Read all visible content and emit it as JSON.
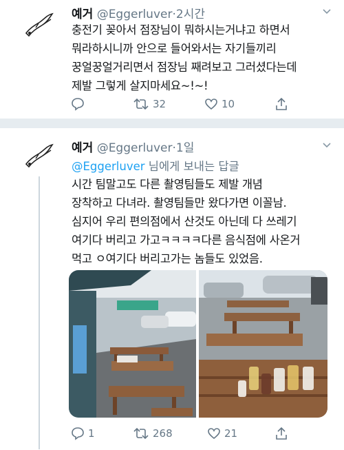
{
  "tweets": [
    {
      "name": "예거",
      "handle": "@Eggerluver",
      "separator": "·",
      "time": "2시간",
      "lines": [
        "충전기 꽂아서 점장님이 뭐하시는거냐고 하면서",
        "뭐라하시니까 안으로 들어와서는 자기들끼리",
        "꿍얼꿍얼거리면서 점장님 째려보고 그러셨다는데",
        "제발 그렇게 살지마세요~!~!"
      ],
      "actions": {
        "reply_count": "",
        "retweet_count": "32",
        "like_count": "10"
      }
    },
    {
      "name": "예거",
      "handle": "@Eggerluver",
      "separator": "·",
      "time": "1일",
      "reply_to": {
        "handle": "@Eggerluver",
        "text": " 님에게 보내는 답글"
      },
      "lines": [
        "시간 팀말고도 다른 촬영팀들도 제발 개념",
        "장착하고 다녀라. 촬영팀들만 왔다가면 이꼴남.",
        "심지어 우리 편의점에서 산것도 아닌데 다 쓰레기",
        "여기다 버리고 가고ㅋㅋㅋㅋ다른 음식점에 사온거",
        "먹고 ㅇ여기다 버리고가는 놈들도 있었음."
      ],
      "actions": {
        "reply_count": "1",
        "retweet_count": "268",
        "like_count": "21"
      }
    }
  ],
  "icons": [
    "avatar-illustration",
    "caret-down-icon",
    "reply-icon",
    "retweet-icon",
    "like-icon",
    "share-icon"
  ],
  "colors": {
    "link": "#1da1f2",
    "muted": "#657786",
    "separator": "#e6ecf0"
  }
}
